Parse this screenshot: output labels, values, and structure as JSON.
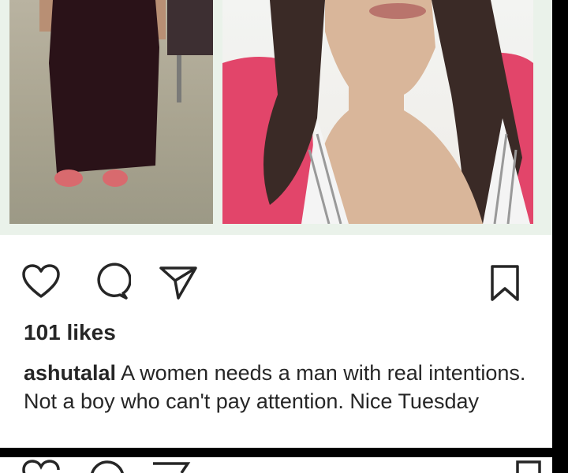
{
  "post": {
    "likes_text": "101 likes",
    "caption": {
      "username": "ashutalal",
      "text": "A women needs a man with real intentions. Not a boy who can't pay attention. Nice  Tuesday"
    },
    "actions": {
      "like_icon": "heart-icon",
      "comment_icon": "comment-icon",
      "share_icon": "paper-plane-icon",
      "save_icon": "bookmark-icon"
    }
  },
  "colors": {
    "text": "#262626",
    "background": "#ffffff",
    "collage_border": "#eaf2ea"
  }
}
